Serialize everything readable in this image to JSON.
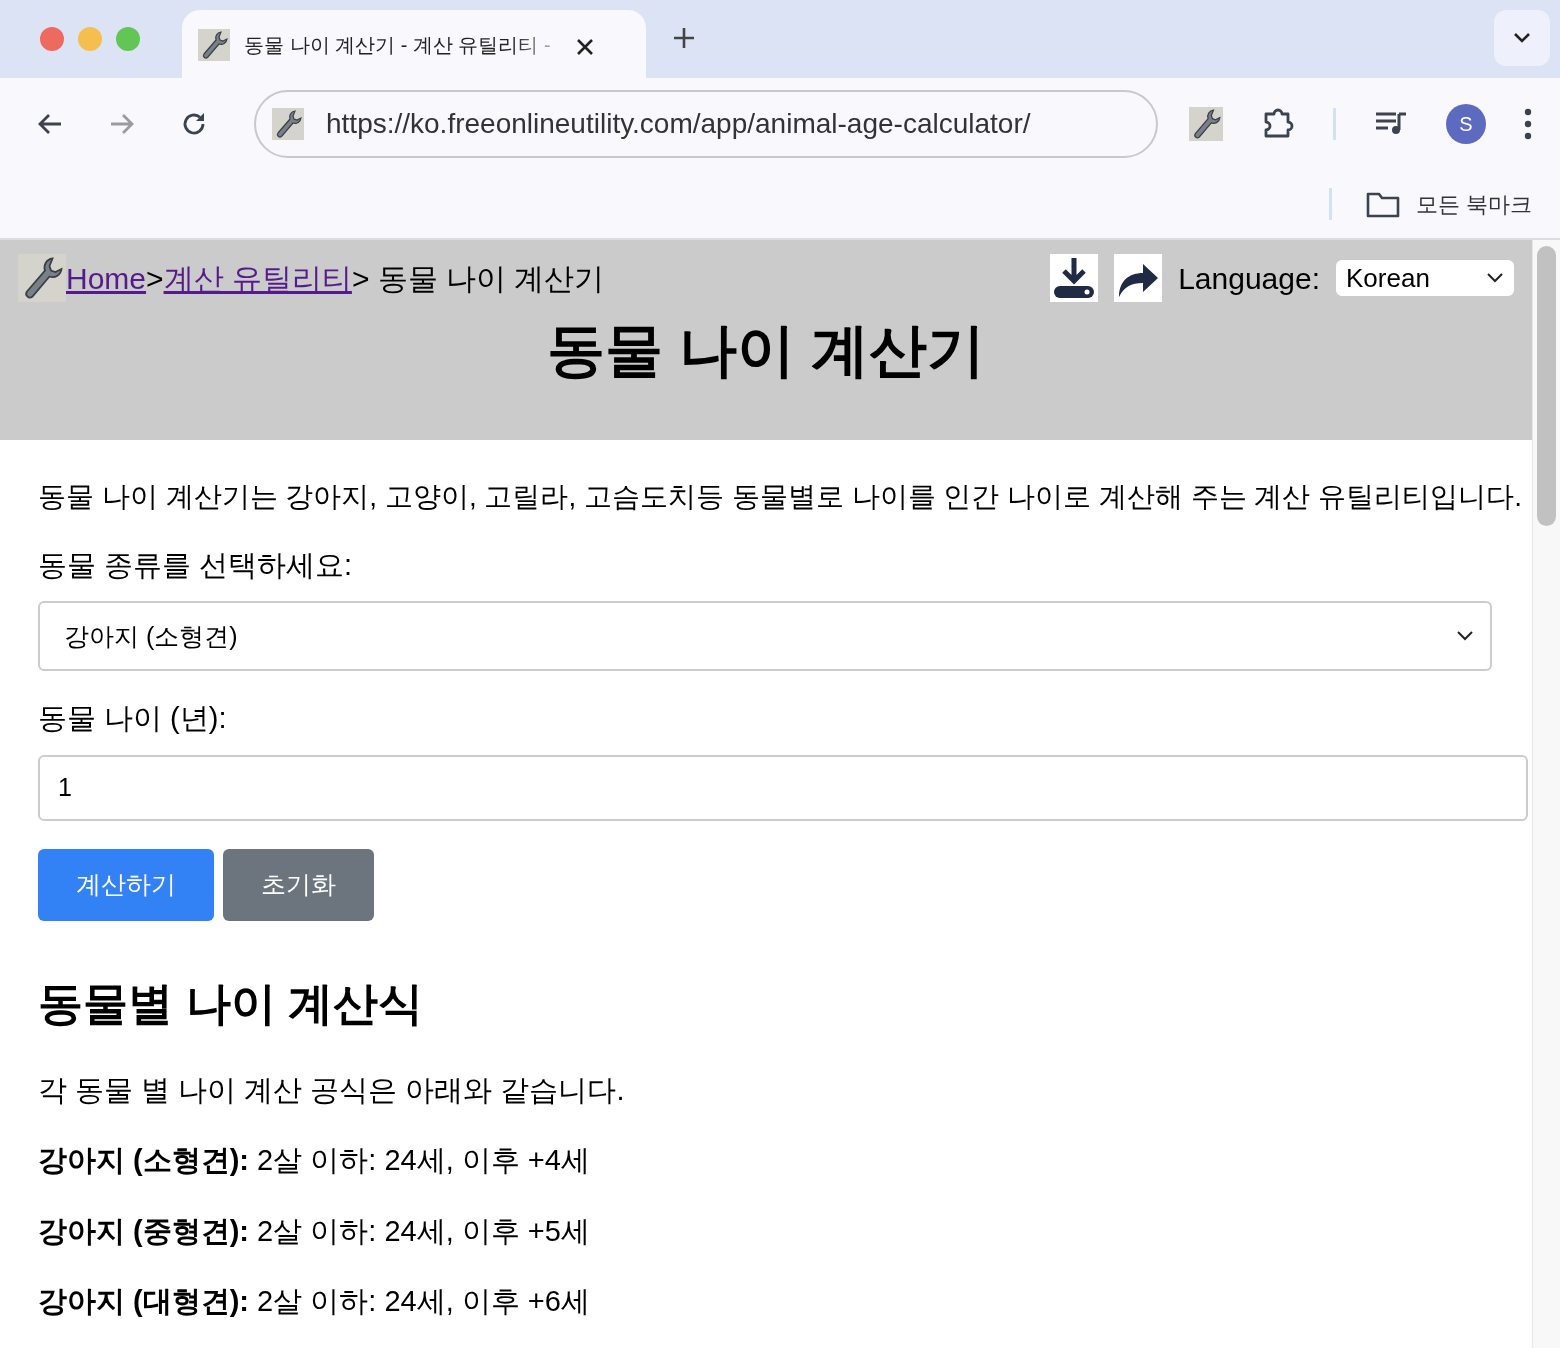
{
  "browser": {
    "tab_title": "동물 나이 계산기 - 계산 유틸리티 -",
    "url": "https://ko.freeonlineutility.com/app/animal-age-calculator/",
    "bookmarks_label": "모든 북마크",
    "profile_initial": "S"
  },
  "header": {
    "breadcrumb": [
      {
        "kind": "link",
        "text": "Home"
      },
      {
        "kind": "text",
        "text": ">"
      },
      {
        "kind": "link",
        "text": "계산 유틸리티"
      },
      {
        "kind": "text",
        "text": "> 동물 나이 계산기"
      }
    ],
    "language_label": "Language:",
    "language_value": "Korean",
    "title": "동물 나이 계산기"
  },
  "description": "동물 나이 계산기는 강아지, 고양이, 고릴라, 고슴도치등 동물별로 나이를 인간 나이로 계산해 주는 계산 유틸리티입니다.",
  "species_label": "동물 종류를 선택하세요:",
  "species_value": "강아지 (소형견)",
  "age_label": "동물 나이 (년):",
  "age_value": "1",
  "buttons": [
    {
      "label": "계산하기",
      "kind": "primary"
    },
    {
      "label": "초기화",
      "kind": "secondary"
    }
  ],
  "section_heading": "동물별 나이 계산식",
  "section_intro": "각 동물 별 나이 계산 공식은 아래와 같습니다.",
  "formulas": [
    "**강아지 (소형견):** 2살 이하: 24세, 이후 +4세",
    "**강아지 (중형견):** 2살 이하: 24세, 이후 +5세",
    "**강아지 (대형견):** 2살 이하: 24세, 이후 +6세"
  ]
}
